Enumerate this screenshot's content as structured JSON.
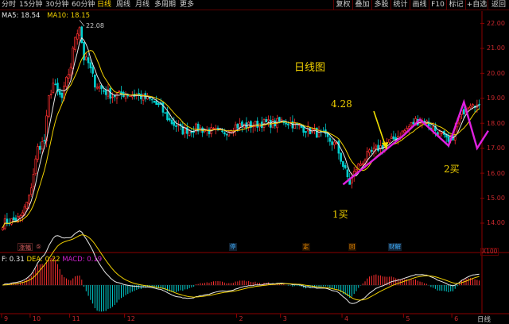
{
  "toolbar": {
    "left_items": [
      {
        "label": "分时"
      },
      {
        "label": "15分钟"
      },
      {
        "label": "30分钟"
      },
      {
        "label": "60分钟"
      },
      {
        "label": "日线"
      },
      {
        "label": "周线"
      },
      {
        "label": "月线"
      },
      {
        "label": "多周期"
      },
      {
        "label": "更多"
      }
    ],
    "right_items": [
      {
        "label": "复权"
      },
      {
        "label": "叠加"
      },
      {
        "label": "多股"
      },
      {
        "label": "统计"
      },
      {
        "label": "画线"
      },
      {
        "label": "F10"
      },
      {
        "label": "标记"
      },
      {
        "label": "+自选"
      },
      {
        "label": "返回"
      }
    ],
    "close_glyph": "✕"
  },
  "indicators": {
    "ma5": "MA5: 18.54",
    "ma10": "MA10: 18.15",
    "macd_dif": "F: 0.31",
    "macd_dea": "DEA: 0.22",
    "macd_value": "MACD: 0.19"
  },
  "annotations": {
    "chart_title": "日线图",
    "date_note": "4.28",
    "buy1": "1买",
    "buy2": "2买",
    "period_label": "日线",
    "high_price": "22.08"
  },
  "event_tags": [
    "涨幅",
    "⑤",
    "停",
    "定",
    "回",
    "财解"
  ],
  "scale_label": "X100",
  "colors": {
    "up": "#ff3030",
    "down": "#00d0d0",
    "ma5": "#e8e8e8",
    "ma10": "#f0d000",
    "trend": "#e020e0",
    "axis": "#8b0000"
  },
  "chart_data": {
    "type": "candlestick",
    "price_axis": [
      "22.00",
      "21.00",
      "20.00",
      "19.00",
      "18.00",
      "17.00",
      "16.00",
      "15.00",
      "14.00"
    ],
    "price_ylim": [
      13.3,
      22.3
    ],
    "date_ticks": [
      {
        "label": "9",
        "index": 0
      },
      {
        "label": "10",
        "index": 13
      },
      {
        "label": "11",
        "index": 31
      },
      {
        "label": "12",
        "index": 56
      },
      {
        "label": "2",
        "index": 107
      },
      {
        "label": "3",
        "index": 127
      },
      {
        "label": "4",
        "index": 155
      },
      {
        "label": "5",
        "index": 183
      },
      {
        "label": "6",
        "index": 205
      }
    ],
    "macd_ylim": [
      -0.4,
      0.45
    ],
    "series": [
      {
        "name": "MA5"
      },
      {
        "name": "MA10"
      }
    ]
  }
}
